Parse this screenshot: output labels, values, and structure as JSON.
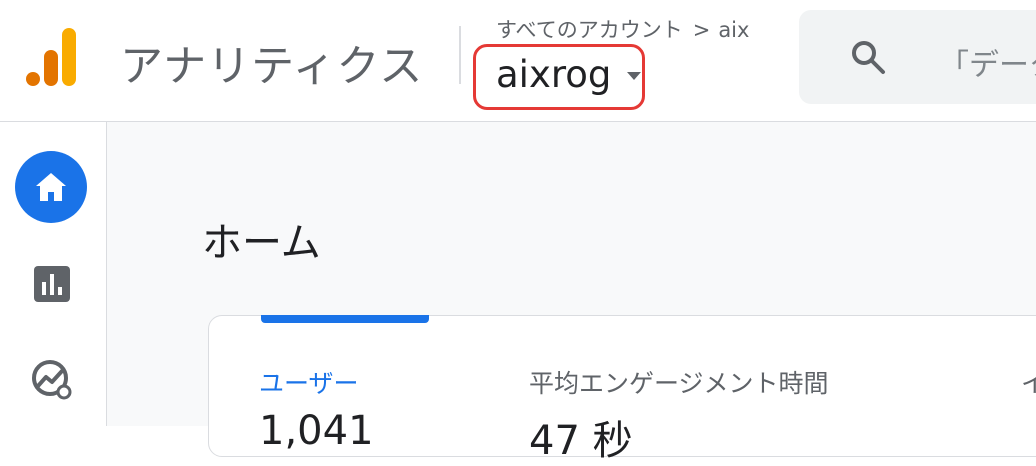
{
  "header": {
    "app_title": "アナリティクス",
    "breadcrumb": {
      "root": "すべてのアカウント",
      "separator": ">",
      "account": "aix"
    },
    "property_name": "aixrog",
    "search_placeholder": "「データ"
  },
  "sidebar": {
    "items": [
      {
        "name": "home",
        "icon": "home-icon",
        "active": true
      },
      {
        "name": "reports",
        "icon": "bar-chart-icon",
        "active": false
      },
      {
        "name": "explore",
        "icon": "explore-icon",
        "active": false
      }
    ]
  },
  "main": {
    "page_title": "ホーム",
    "metrics": [
      {
        "label": "ユーザー",
        "value": "1,041",
        "selected": true
      },
      {
        "label": "平均エンゲージメント時間",
        "value": "47 秒",
        "selected": false
      },
      {
        "label": "イ",
        "value": "",
        "selected": false
      }
    ]
  },
  "colors": {
    "accent": "#1a73e8",
    "highlight_border": "#e53935",
    "logo_orange": "#f9ab00",
    "logo_dark_orange": "#e37400"
  }
}
